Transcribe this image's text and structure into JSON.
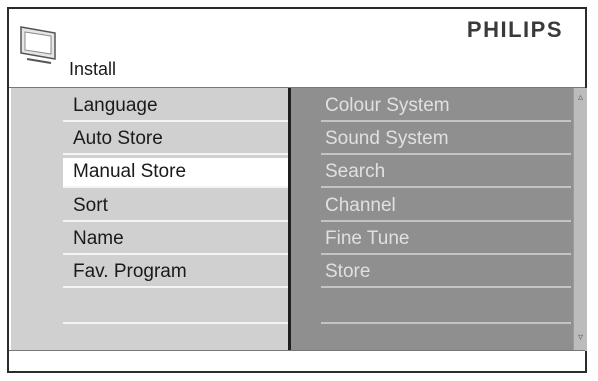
{
  "brand": "PHILIPS",
  "title": "Install",
  "left_menu": [
    {
      "label": "Language",
      "selected": false
    },
    {
      "label": "Auto Store",
      "selected": false
    },
    {
      "label": "Manual Store",
      "selected": true
    },
    {
      "label": "Sort",
      "selected": false
    },
    {
      "label": "Name",
      "selected": false
    },
    {
      "label": "Fav. Program",
      "selected": false
    }
  ],
  "right_menu": [
    "Colour System",
    "Sound System",
    "Search",
    "Channel",
    "Fine Tune",
    "Store"
  ],
  "scroll": {
    "up_icon": "triangle-up",
    "down_icon": "triangle-down"
  },
  "colors": {
    "left_bg": "#d0d0d0",
    "right_bg": "#8f8f8f",
    "selected_bg": "#ffffff"
  }
}
